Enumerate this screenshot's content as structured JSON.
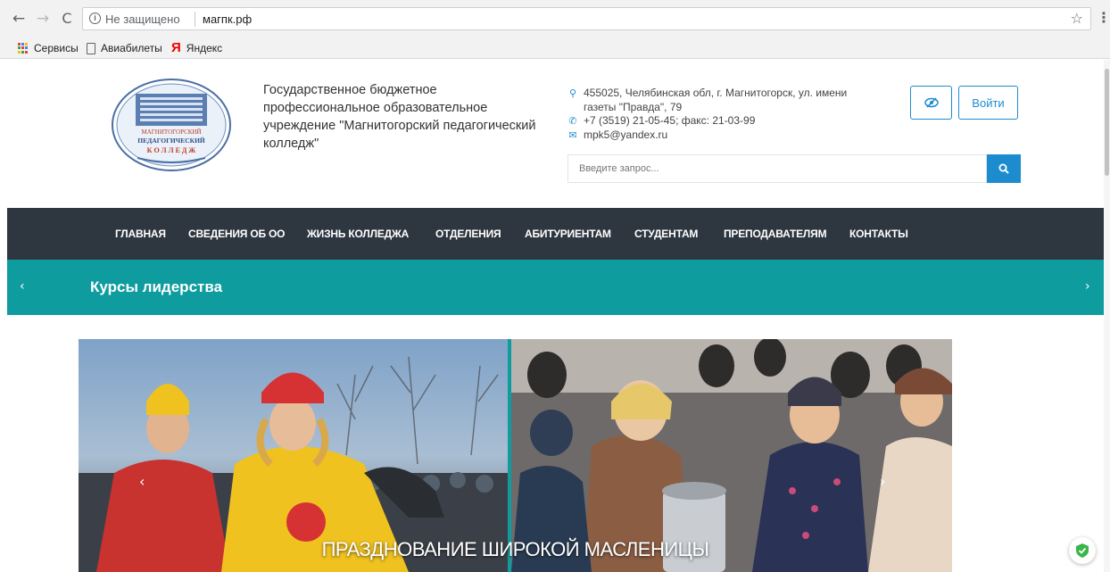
{
  "browser": {
    "back_icon": "arrow-left-icon",
    "forward_icon": "arrow-right-icon",
    "reload_icon": "reload-icon",
    "insecure_label": "Не защищено",
    "url": "магпк.рф",
    "bookmarks": [
      {
        "label": "Сервисы",
        "icon": "apps-icon"
      },
      {
        "label": "Авиабилеты",
        "icon": "page-icon"
      },
      {
        "label": "Яндекс",
        "icon": "yandex-icon"
      }
    ]
  },
  "header": {
    "org_name": "Государственное бюджетное профессиональное образовательное учреждение \"Магнитогорский педагогический колледж\"",
    "logo_text": {
      "line1": "МАГНИТОГОРСКИЙ",
      "line2": "ПЕДАГОГИЧЕСКИЙ",
      "line3": "К О Л Л Е Д Ж"
    },
    "address": "455025, Челябинская обл, г. Магнитогорск, ул. имени газеты \"Правда\", 79",
    "phone": "+7 (3519) 21-05-45; факс: 21-03-99",
    "email": "mpk5@yandex.ru",
    "login_label": "Войти",
    "search_placeholder": "Введите запрос..."
  },
  "menu": {
    "items": [
      "ГЛАВНАЯ",
      "СВЕДЕНИЯ ОБ ОО",
      "ЖИЗНЬ КОЛЛЕДЖА",
      "ОТДЕЛЕНИЯ",
      "АБИТУРИЕНТАМ",
      "СТУДЕНТАМ",
      "ПРЕПОДАВАТЕЛЯМ",
      "КОНТАКТЫ"
    ]
  },
  "banner": {
    "title": "Курсы лидерства"
  },
  "slider": {
    "caption": "ПРАЗДНОВАНИЕ ШИРОКОЙ МАСЛЕНИЦЫ"
  },
  "colors": {
    "accent": "#1c8ccf",
    "menu_bg": "#2e3640",
    "banner_bg": "#0e9c9f"
  }
}
